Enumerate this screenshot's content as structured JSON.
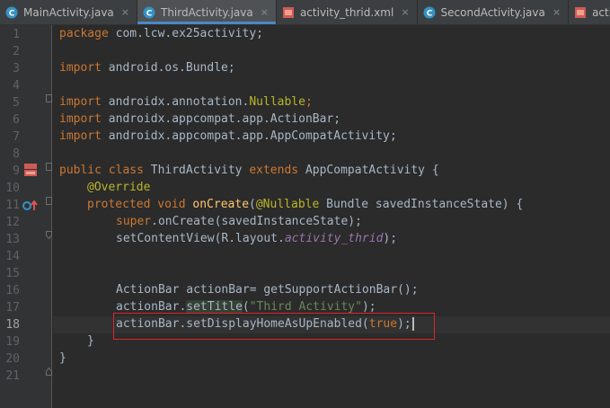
{
  "tabs": [
    {
      "label": "MainActivity.java",
      "icon": "java-class-icon",
      "active": false
    },
    {
      "label": "ThirdActivity.java",
      "icon": "java-class-icon",
      "active": true
    },
    {
      "label": "activity_thrid.xml",
      "icon": "xml-file-icon",
      "active": false
    },
    {
      "label": "SecondActivity.java",
      "icon": "java-class-icon",
      "active": false
    },
    {
      "label": "activity_second",
      "icon": "xml-file-icon",
      "active": false
    }
  ],
  "tab_close_glyph": "×",
  "editor": {
    "current_line": 18,
    "line_numbers": [
      "1",
      "2",
      "3",
      "4",
      "5",
      "6",
      "7",
      "8",
      "9",
      "10",
      "11",
      "12",
      "13",
      "14",
      "15",
      "16",
      "17",
      "18",
      "19",
      "20",
      "21"
    ],
    "lines": {
      "l1_kw": "package",
      "l1_rest": " com.lcw.ex25activity;",
      "l3_kw": "import",
      "l3_rest": " android.os.Bundle;",
      "l5_kw": "import",
      "l5_pkg": " androidx.annotation.",
      "l5_cls": "Nullable",
      "l5_semi": ";",
      "l6_kw": "import",
      "l6_rest": " androidx.appcompat.app.ActionBar;",
      "l7_kw": "import",
      "l7_rest": " androidx.appcompat.app.AppCompatActivity;",
      "l9_kw1": "public class",
      "l9_name": " ThirdActivity ",
      "l9_kw2": "extends",
      "l9_rest": " AppCompatActivity {",
      "l10_ann": "@Override",
      "l11_kw": "protected void",
      "l11_sp": " ",
      "l11_fn": "onCreate",
      "l11_paren": "(",
      "l11_ann": "@Nullable",
      "l11_rest": " Bundle savedInstanceState) {",
      "l12_kw": "super",
      "l12_rest": ".onCreate(savedInstanceState);",
      "l13_a": "setContentView(R.layout.",
      "l13_b": "activity_thrid",
      "l13_c": ");",
      "l16": "ActionBar actionBar= getSupportActionBar();",
      "l17_a": "actionBar.",
      "l17_b": "setTitle",
      "l17_c": "(",
      "l17_d": "\"Third Activity\"",
      "l17_e": ");",
      "l18_a": "actionBar.setDisplayHomeAsUpEnabled(",
      "l18_b": "true",
      "l18_c": ");",
      "l19": "}",
      "l20": "}"
    }
  },
  "colors": {
    "background": "#2b2b2b",
    "keyword": "#cc7832",
    "annotation": "#bbb529",
    "method": "#ffc66d",
    "string": "#6a8759",
    "field": "#9876aa",
    "default_text": "#a9b7c6",
    "highlight_box": "#e0242b",
    "active_tab_underline": "#4a88c7"
  }
}
